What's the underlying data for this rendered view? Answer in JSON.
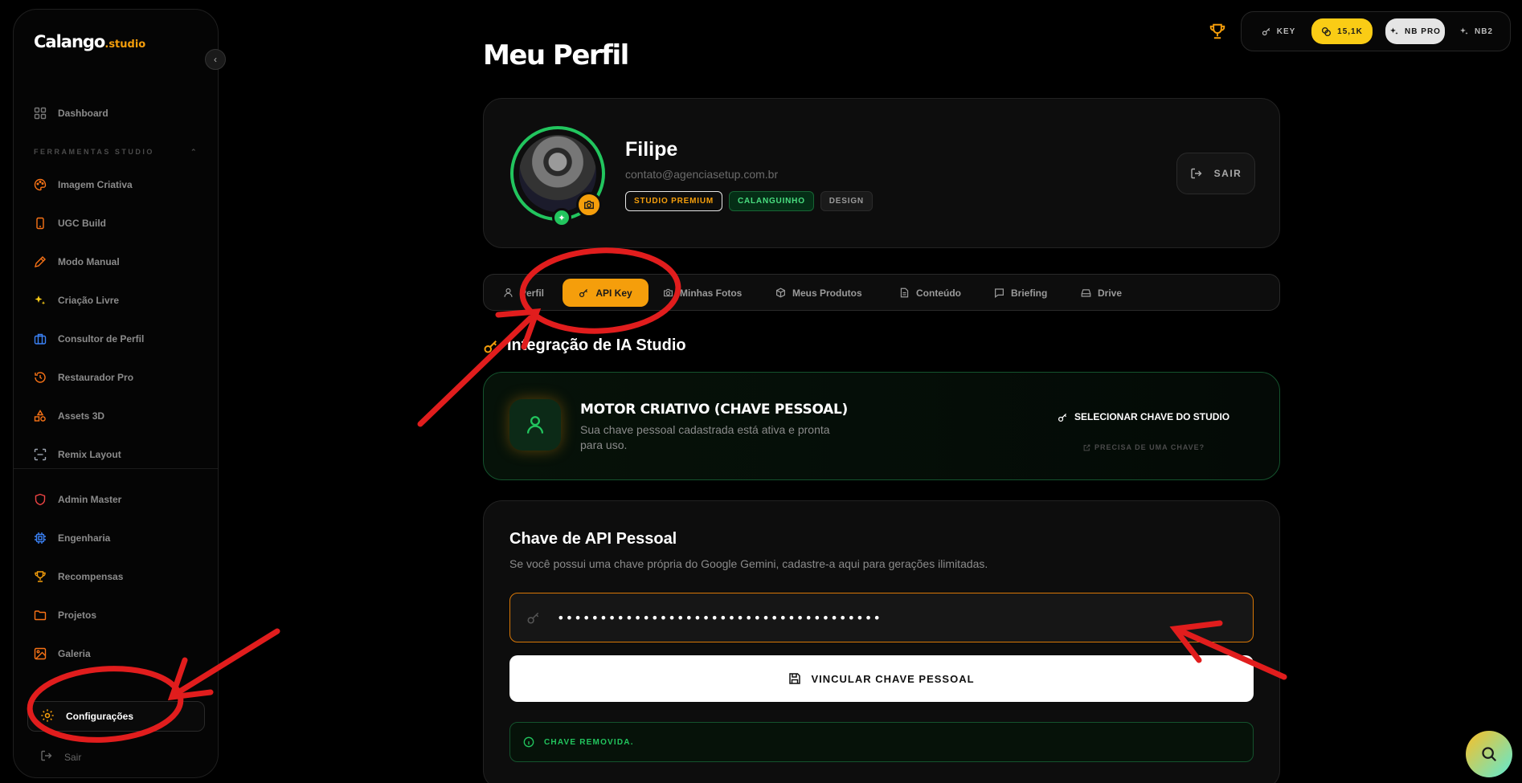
{
  "app": {
    "logo_text": "Calango",
    "logo_suffix": ".studio"
  },
  "sidebar": {
    "section_label": "FERRAMENTAS STUDIO",
    "items": [
      {
        "label": "Dashboard",
        "icon": "grid-icon"
      },
      {
        "label": "Imagem Criativa",
        "icon": "palette-icon"
      },
      {
        "label": "UGC Build",
        "icon": "smartphone-icon"
      },
      {
        "label": "Modo Manual",
        "icon": "pencil-ruler-icon"
      },
      {
        "label": "Criação Livre",
        "icon": "sparkles-icon"
      },
      {
        "label": "Consultor de Perfil",
        "icon": "briefcase-icon"
      },
      {
        "label": "Restaurador Pro",
        "icon": "history-icon"
      },
      {
        "label": "Assets 3D",
        "icon": "shapes-icon"
      },
      {
        "label": "Remix Layout",
        "icon": "scan-icon"
      },
      {
        "label": "Admin Master",
        "icon": "shield-icon"
      },
      {
        "label": "Engenharia",
        "icon": "cpu-icon"
      },
      {
        "label": "Recompensas",
        "icon": "trophy-icon"
      },
      {
        "label": "Projetos",
        "icon": "folder-icon"
      },
      {
        "label": "Galeria",
        "icon": "image-icon"
      }
    ],
    "settings_label": "Configurações",
    "logout_label": "Sair"
  },
  "topbar": {
    "key_label": "KEY",
    "credits": "15,1K",
    "nb_pro_label": "NB PRO",
    "nb2_label": "NB2"
  },
  "page": {
    "title": "Meu Perfil"
  },
  "profile": {
    "name": "Filipe",
    "email": "contato@agenciasetup.com.br",
    "badges": [
      "STUDIO PREMIUM",
      "CALANGUINHO",
      "DESIGN"
    ],
    "logout_button": "SAIR"
  },
  "tabs": [
    {
      "label": "Perfil",
      "icon": "user-icon",
      "active": false
    },
    {
      "label": "API Key",
      "icon": "key-icon",
      "active": true
    },
    {
      "label": "Minhas Fotos",
      "icon": "camera-icon",
      "active": false
    },
    {
      "label": "Meus Produtos",
      "icon": "box-icon",
      "active": false
    },
    {
      "label": "Conteúdo",
      "icon": "file-icon",
      "active": false
    },
    {
      "label": "Briefing",
      "icon": "message-icon",
      "active": false
    },
    {
      "label": "Drive",
      "icon": "hard-drive-icon",
      "active": false
    }
  ],
  "integration": {
    "section_title": "Integração de IA Studio",
    "motor_title": "MOTOR CRIATIVO (CHAVE PESSOAL)",
    "motor_desc": "Sua chave pessoal cadastrada está ativa e pronta para uso.",
    "select_key_label": "SELECIONAR CHAVE DO STUDIO",
    "need_key_label": "PRECISA DE UMA CHAVE?"
  },
  "api_key": {
    "title": "Chave de API Pessoal",
    "description": "Se você possui uma chave própria do Google Gemini, cadastre-a aqui para gerações ilimitadas.",
    "input_value": "••••••••••••••••••••••••••••••••••••••",
    "submit_label": "VINCULAR CHAVE PESSOAL",
    "status_text": "CHAVE REMOVIDA."
  },
  "colors": {
    "accent": "#f59e0b",
    "success": "#22c55e",
    "annotation": "#e11d1d",
    "background": "#000000"
  }
}
